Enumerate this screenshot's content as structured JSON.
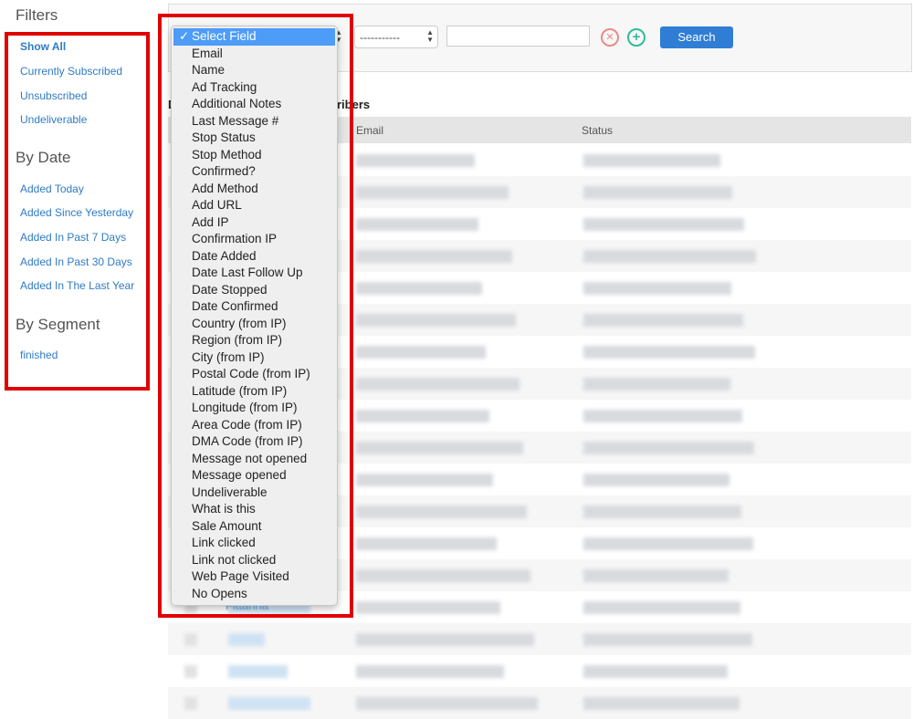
{
  "sidebar": {
    "filters_title": "Filters",
    "filters": [
      "Show All",
      "Currently Subscribed",
      "Unsubscribed",
      "Undeliverable"
    ],
    "by_date_title": "By Date",
    "by_date": [
      "Added Today",
      "Added Since Yesterday",
      "Added In Past 7 Days",
      "Added In Past 30 Days",
      "Added In The Last Year"
    ],
    "by_segment_title": "By Segment",
    "segments": [
      "finished"
    ]
  },
  "search_bar": {
    "field_select": {
      "selected": "Select Field",
      "options": [
        "Select Field",
        "Email",
        "Name",
        "Ad Tracking",
        "Additional Notes",
        "Last Message #",
        "Stop Status",
        "Stop Method",
        "Confirmed?",
        "Add Method",
        "Add URL",
        "Add IP",
        "Confirmation IP",
        "Date Added",
        "Date Last Follow Up",
        "Date Stopped",
        "Date Confirmed",
        "Country (from IP)",
        "Region (from IP)",
        "City (from IP)",
        "Postal Code (from IP)",
        "Latitude (from IP)",
        "Longitude (from IP)",
        "Area Code (from IP)",
        "DMA Code (from IP)",
        "Message not opened",
        "Message opened",
        "Undeliverable",
        "What is this",
        "Sale Amount",
        "Link clicked",
        "Link not clicked",
        "Web Page Visited",
        "No Opens"
      ]
    },
    "operator_select": "-----------",
    "value_input": "",
    "search_label": "Search",
    "check_mark": "✓",
    "remove_icon": "circle-x-icon",
    "add_icon": "circle-plus-icon"
  },
  "table": {
    "heading_start": "D",
    "heading_end": "ribers",
    "columns": [
      "Email",
      "Status"
    ],
    "visible_name": "Fittarina"
  },
  "colors": {
    "highlight": "#e00000",
    "accent": "#2f7dd4",
    "link": "#2f7bc4"
  }
}
